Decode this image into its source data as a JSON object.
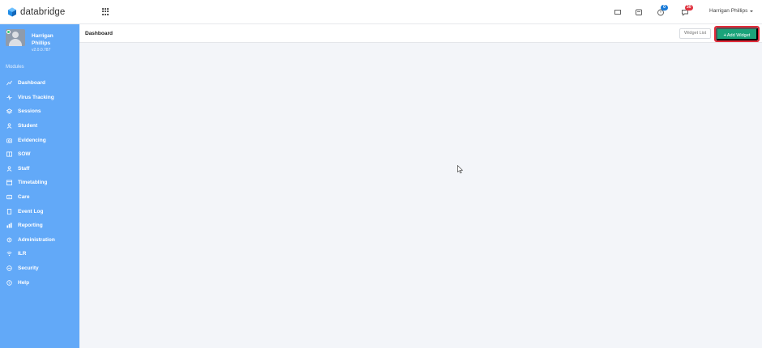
{
  "brand": {
    "name": "databridge",
    "logo_color": "#1e8be6"
  },
  "topbar": {
    "notifications_badge": "0",
    "messages_badge": "30",
    "user_name": "Harrigan Phillips"
  },
  "profile": {
    "name": "Harrigan Phillips",
    "version": "v2.0.0.787"
  },
  "sidebar": {
    "section_label": "Modules",
    "items": [
      {
        "label": "Dashboard",
        "icon": "chart-icon"
      },
      {
        "label": "Virus Tracking",
        "icon": "pulse-icon"
      },
      {
        "label": "Sessions",
        "icon": "layers-icon"
      },
      {
        "label": "Student",
        "icon": "student-icon"
      },
      {
        "label": "Evidencing",
        "icon": "camera-icon"
      },
      {
        "label": "SOW",
        "icon": "book-icon"
      },
      {
        "label": "Staff",
        "icon": "staff-icon"
      },
      {
        "label": "Timetabling",
        "icon": "calendar-icon"
      },
      {
        "label": "Care",
        "icon": "care-icon"
      },
      {
        "label": "Event Log",
        "icon": "log-icon"
      },
      {
        "label": "Reporting",
        "icon": "report-icon"
      },
      {
        "label": "Administration",
        "icon": "gear-icon"
      },
      {
        "label": "ILR",
        "icon": "signal-icon"
      },
      {
        "label": "Security",
        "icon": "shield-icon"
      },
      {
        "label": "Help",
        "icon": "help-icon"
      }
    ]
  },
  "page": {
    "title": "Dashboard",
    "widget_list_label": "Widget List",
    "add_widget_label": "Add Widget"
  },
  "colors": {
    "sidebar": "#62a9f8",
    "accent_green": "#1aa37a",
    "highlight_red": "#e22b3a",
    "badge_blue": "#1a7bd8",
    "badge_red": "#e0323f"
  }
}
